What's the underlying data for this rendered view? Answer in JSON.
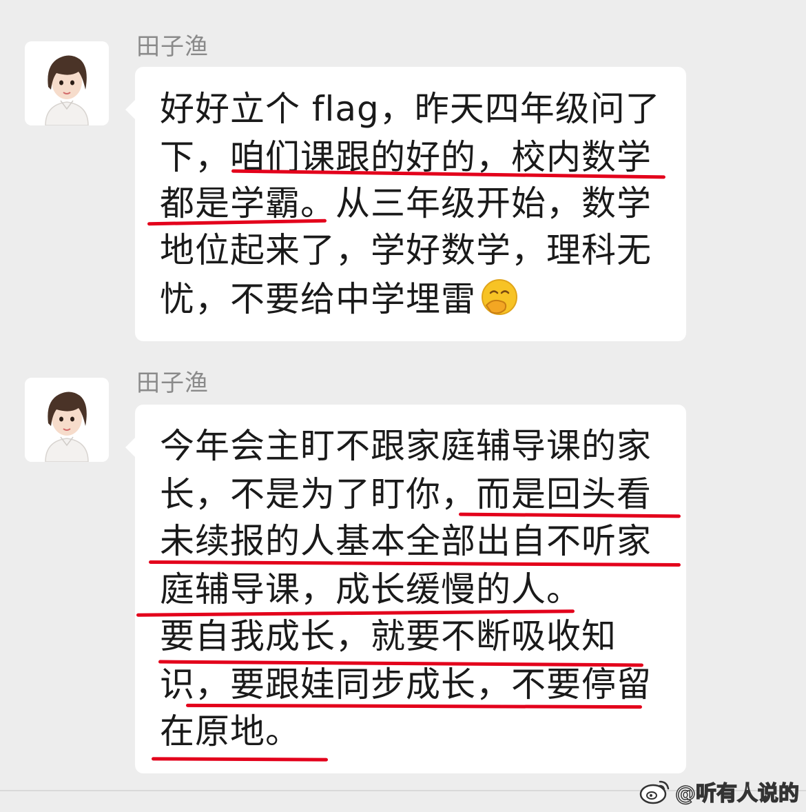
{
  "messages": [
    {
      "sender": "田子渔",
      "avatar_icon": "girl-avatar-icon",
      "lines": [
        "好好立个 flag，昨天四年级问了",
        "下，咱们课跟的好的，校内数学",
        "都是学霸。从三年级开始，数学",
        "地位起来了，学好数学，理科无",
        "忧，不要给中学埋雷"
      ],
      "trailing_emoji": "smirk-emoji-icon"
    },
    {
      "sender": "田子渔",
      "avatar_icon": "girl-avatar-icon",
      "lines": [
        "今年会主盯不跟家庭辅导课的家",
        "长，不是为了盯你，而是回头看",
        "未续报的人基本全部出自不听家",
        "庭辅导课，成长缓慢的人。",
        "要自我成长，就要不断吸收知",
        "识，要跟娃同步成长，不要停留",
        "在原地。"
      ]
    }
  ],
  "underline_color": "#e3001b",
  "watermark": {
    "text": "@听有人说的",
    "icon": "weibo-logo-icon"
  }
}
